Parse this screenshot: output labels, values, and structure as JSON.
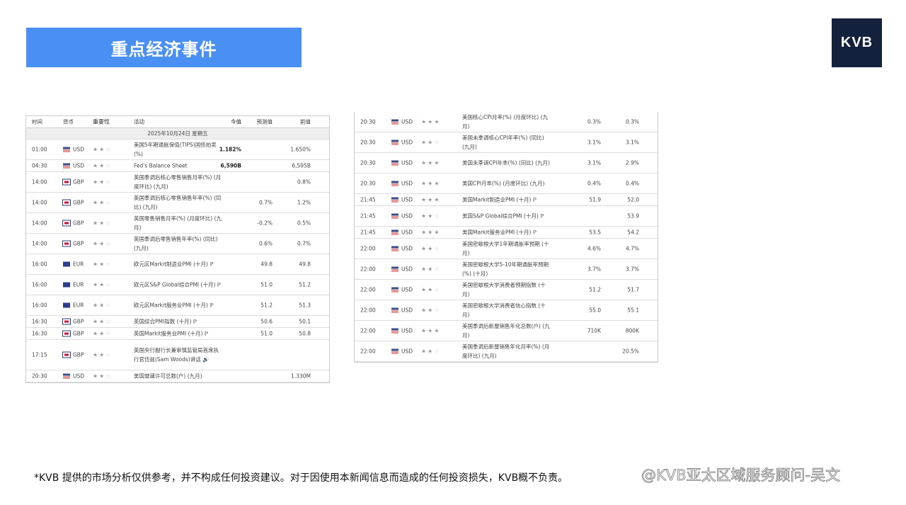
{
  "banner_title": "重点经济事件",
  "logo": "KVB",
  "headers": {
    "time": "时间",
    "currency": "货币",
    "importance": "重要性",
    "activity": "活动",
    "actual": "今值",
    "forecast": "预测值",
    "previous": "前值"
  },
  "date_row": "2025年10月24日 星期五",
  "left_rows": [
    {
      "time": "01:00",
      "currency": "USD",
      "importance": 2,
      "activity": "美国5年期通胀保值(TIPS)国债拍卖(%)",
      "actual": "1.182%",
      "forecast": "",
      "previous": "1.650%"
    },
    {
      "time": "04:30",
      "currency": "USD",
      "importance": 2,
      "activity": "Fed's Balance Sheet",
      "actual": "6,590B",
      "forecast": "",
      "previous": "6,595B",
      "short": true
    },
    {
      "time": "14:00",
      "currency": "GBP",
      "importance": 2,
      "activity": "英国季调后核心零售销售月率(%) (月度环比) (九月)",
      "actual": "",
      "forecast": "",
      "previous": "0.8%"
    },
    {
      "time": "14:00",
      "currency": "GBP",
      "importance": 2,
      "activity": "英国季调后核心零售销售年率(%) (同比) (九月)",
      "actual": "",
      "forecast": "0.7%",
      "previous": "1.2%"
    },
    {
      "time": "14:00",
      "currency": "GBP",
      "importance": 2,
      "activity": "英国零售销售月率(%) (月度环比) (九月)",
      "actual": "",
      "forecast": "-0.2%",
      "previous": "0.5%"
    },
    {
      "time": "14:00",
      "currency": "GBP",
      "importance": 2,
      "activity": "英国季调后零售销售年率(%) (同比) (九月)",
      "actual": "",
      "forecast": "0.6%",
      "previous": "0.7%"
    },
    {
      "time": "16:00",
      "currency": "EUR",
      "importance": 2,
      "activity": "欧元区Markit制造业PMI (十月) ℙ",
      "actual": "",
      "forecast": "49.8",
      "previous": "49.8"
    },
    {
      "time": "16:00",
      "currency": "EUR",
      "importance": 2,
      "activity": "欧元区S&P Global综合PMI (十月) ℙ",
      "actual": "",
      "forecast": "51.0",
      "previous": "51.2"
    },
    {
      "time": "16:00",
      "currency": "EUR",
      "importance": 2,
      "activity": "欧元区Markit服务业PMI (十月) ℙ",
      "actual": "",
      "forecast": "51.2",
      "previous": "51.3"
    },
    {
      "time": "16:30",
      "currency": "GBP",
      "importance": 2,
      "activity": "英国综合PMI指数 (十月) ℙ",
      "actual": "",
      "forecast": "50.6",
      "previous": "50.1",
      "short": true
    },
    {
      "time": "16:30",
      "currency": "GBP",
      "importance": 2,
      "activity": "英国Markit服务业PMI (十月) ℙ",
      "actual": "",
      "forecast": "51.0",
      "previous": "50.8",
      "short": true
    },
    {
      "time": "17:15",
      "currency": "GBP",
      "importance": 2,
      "activity": "英国央行副行长兼审慎监管局首席执行官伍兹(Sam Woods)讲话 🔊",
      "actual": "",
      "forecast": "",
      "previous": "",
      "tall": true
    },
    {
      "time": "20:30",
      "currency": "USD",
      "importance": 2,
      "activity": "美国营建许可总数(户) (九月)",
      "actual": "",
      "forecast": "",
      "previous": "1.330M",
      "short": true
    }
  ],
  "right_rows": [
    {
      "time": "20:30",
      "currency": "USD",
      "importance": 3,
      "activity": "美国核心CPI月率(%) (月度环比) (九月)",
      "actual": "",
      "forecast": "0.3%",
      "previous": "0.3%"
    },
    {
      "time": "20:30",
      "currency": "USD",
      "importance": 2,
      "activity": "美国未季调核心CPI年率(%) (同比) (九月)",
      "actual": "",
      "forecast": "3.1%",
      "previous": "3.1%"
    },
    {
      "time": "20:30",
      "currency": "USD",
      "importance": 3,
      "activity": "美国未季调CPI年率(%) (同比) (九月)",
      "actual": "",
      "forecast": "3.1%",
      "previous": "2.9%"
    },
    {
      "time": "20:30",
      "currency": "USD",
      "importance": 3,
      "activity": "美国CPI月率(%) (月度环比) (九月)",
      "actual": "",
      "forecast": "0.4%",
      "previous": "0.4%"
    },
    {
      "time": "21:45",
      "currency": "USD",
      "importance": 3,
      "activity": "美国Markit制造业PMI (十月) ℙ",
      "actual": "",
      "forecast": "51.9",
      "previous": "52.0",
      "short": true
    },
    {
      "time": "21:45",
      "currency": "USD",
      "importance": 2,
      "activity": "美国S&P Global综合PMI (十月) ℙ",
      "actual": "",
      "forecast": "",
      "previous": "53.9"
    },
    {
      "time": "21:45",
      "currency": "USD",
      "importance": 3,
      "activity": "美国Markit服务业PMI (十月) ℙ",
      "actual": "",
      "forecast": "53.5",
      "previous": "54.2",
      "short": true
    },
    {
      "time": "22:00",
      "currency": "USD",
      "importance": 2,
      "activity": "美国密歇根大学1年期通胀率预期 (十月)",
      "actual": "",
      "forecast": "4.6%",
      "previous": "4.7%"
    },
    {
      "time": "22:00",
      "currency": "USD",
      "importance": 2,
      "activity": "美国密歇根大学5-10年期通胀率预期(%) (十月)",
      "actual": "",
      "forecast": "3.7%",
      "previous": "3.7%"
    },
    {
      "time": "22:00",
      "currency": "USD",
      "importance": 2,
      "activity": "美国密歇根大学消费者预期指数 (十月)",
      "actual": "",
      "forecast": "51.2",
      "previous": "51.7"
    },
    {
      "time": "22:00",
      "currency": "USD",
      "importance": 2,
      "activity": "美国密歇根大学消费者信心指数 (十月)",
      "actual": "",
      "forecast": "55.0",
      "previous": "55.1"
    },
    {
      "time": "22:00",
      "currency": "USD",
      "importance": 3,
      "activity": "美国季调后新屋销售年化总数(户) (九月)",
      "actual": "",
      "forecast": "710K",
      "previous": "800K"
    },
    {
      "time": "22:00",
      "currency": "USD",
      "importance": 2,
      "activity": "美国季调后新屋销售年化月率(%) (月度环比) (九月)",
      "actual": "",
      "forecast": "",
      "previous": "20.5%"
    }
  ],
  "footer": "*KVB 提供的市场分析仅供参考，并不构成任何投资建议。对于因使用本新闻信息而造成的任何投资损失，KVB概不负责。",
  "watermark": "@KVB亚太区域服务顾问-吴文",
  "colors": {
    "banner": "#4a8ff4",
    "logo_bg": "#14213d"
  }
}
